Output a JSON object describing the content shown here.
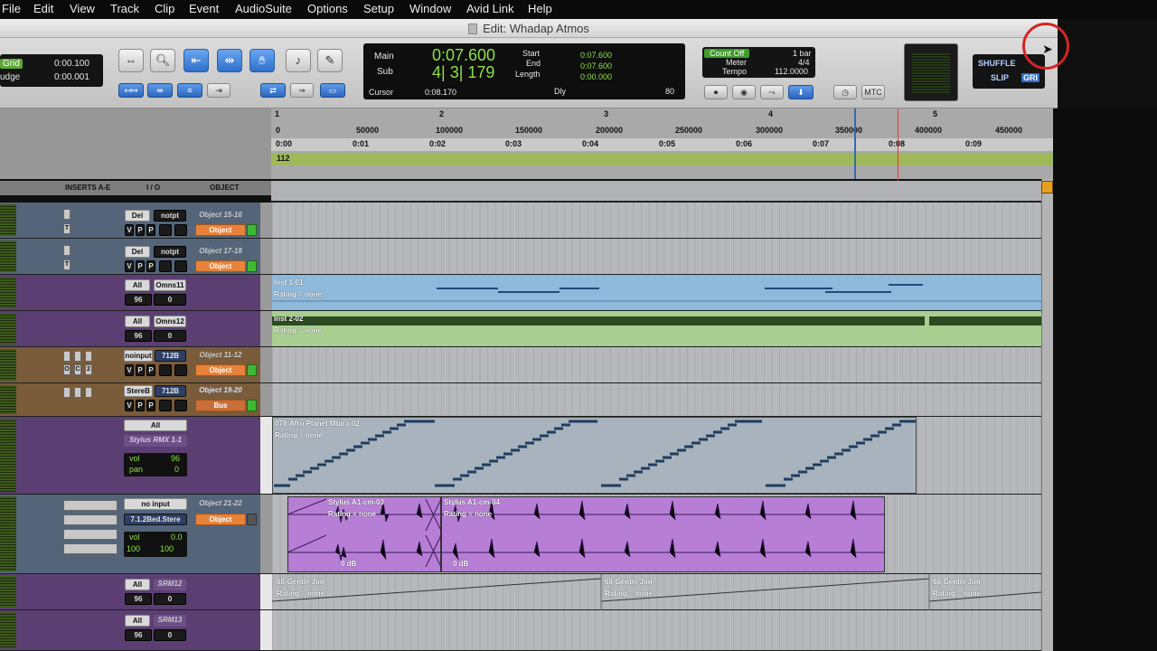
{
  "menu": [
    "File",
    "Edit",
    "View",
    "Track",
    "Clip",
    "Event",
    "AudioSuite",
    "Options",
    "Setup",
    "Window",
    "Avid Link",
    "Help"
  ],
  "window_title": "Edit: Whadap Atmos",
  "grid_nudge": {
    "grid_label": "Grid",
    "grid_value": "0:00.100",
    "nudge_label": "udge",
    "nudge_value": "0:00.001"
  },
  "counter": {
    "main_label": "Main",
    "main_value": "0:07.600",
    "sub_label": "Sub",
    "sub_value": "4| 3| 179",
    "cursor_label": "Cursor",
    "cursor_value": "0:08.170",
    "start_label": "Start",
    "start_value": "0:07.600",
    "end_label": "End",
    "end_value": "0:07.600",
    "length_label": "Length",
    "length_value": "0:00.000",
    "dly_label": "Dly",
    "dly_value": "80"
  },
  "midi_ctrl": {
    "count_off": "Count Off",
    "count_bars": "1 bar",
    "meter_label": "Meter",
    "meter_value": "4/4",
    "tempo_label": "Tempo",
    "tempo_value": "112.0000",
    "mtc": "MTC"
  },
  "edit_modes": {
    "shuffle": "SHUFFLE",
    "slip": "SLIP",
    "grid": "GRI"
  },
  "rulers": {
    "bars": [
      "1",
      "2",
      "3",
      "4",
      "5"
    ],
    "samples": [
      "0",
      "50000",
      "100000",
      "150000",
      "200000",
      "250000",
      "300000",
      "350000",
      "400000",
      "450000"
    ],
    "minsecs": [
      "0:00",
      "0:01",
      "0:02",
      "0:03",
      "0:04",
      "0:05",
      "0:06",
      "0:07",
      "0:08",
      "0:09"
    ],
    "tempo_marker": "112"
  },
  "column_headers": {
    "inserts": "INSERTS A-E",
    "io": "I / O",
    "object": "OBJECT"
  },
  "tracks": [
    {
      "io_in": "Del",
      "io_out": "notpt",
      "obj": "Object 15-16",
      "btn": "Object",
      "tg": [
        "T"
      ],
      "vpp": [
        "V",
        "P",
        "P"
      ]
    },
    {
      "io_in": "Del",
      "io_out": "notpt",
      "obj": "Object 17-18",
      "btn": "Object",
      "tg": [
        "T"
      ],
      "vpp": [
        "V",
        "P",
        "P"
      ]
    },
    {
      "io_in": "All",
      "io_out": "Omns11",
      "vol": "96",
      "pan": "0",
      "clip": "Inst 1-01",
      "rating": "Rating = none"
    },
    {
      "io_in": "All",
      "io_out": "Omns12",
      "vol": "96",
      "pan": "0",
      "clip": "Inst 2-02",
      "rating": "Rating = none"
    },
    {
      "io_in": "noinput",
      "io_out": "712B",
      "obj": "Object 11-12",
      "btn": "Object",
      "ocz": [
        "O",
        "C",
        "2"
      ],
      "vpp": [
        "V",
        "P",
        "P"
      ]
    },
    {
      "io_in": "StereB",
      "io_out": "712B",
      "obj": "Object 19-20",
      "btn": "Bus",
      "vpp": [
        "V",
        "P",
        "P"
      ]
    },
    {
      "io_in": "All",
      "plugin": "Stylus RMX 1-1",
      "vol_label": "vol",
      "vol": "96",
      "pan_label": "pan",
      "pan": "0",
      "clip": "078-Afro Planet Mbira-02",
      "rating": "Rating = none"
    },
    {
      "io_in": "no input",
      "io_out": "7.1.2Bed.Stere",
      "obj": "Object 21-22",
      "btn": "Object",
      "vol_label": "vol",
      "vol": "0.0",
      "pan_l": "100",
      "pan_r": "100",
      "clip_a": "Stylus A1-cm-03",
      "clip_b": "Stylus A1-cm-04",
      "rating": "Rating = none",
      "gain": "0 dB"
    },
    {
      "io_in": "All",
      "io_out": "SRM12",
      "vol": "96",
      "pan": "0",
      "clip": "68-Gentle Jim",
      "rating": "Rating = none"
    },
    {
      "io_in": "All",
      "io_out": "SRM13",
      "vol": "96",
      "pan": "0"
    }
  ]
}
